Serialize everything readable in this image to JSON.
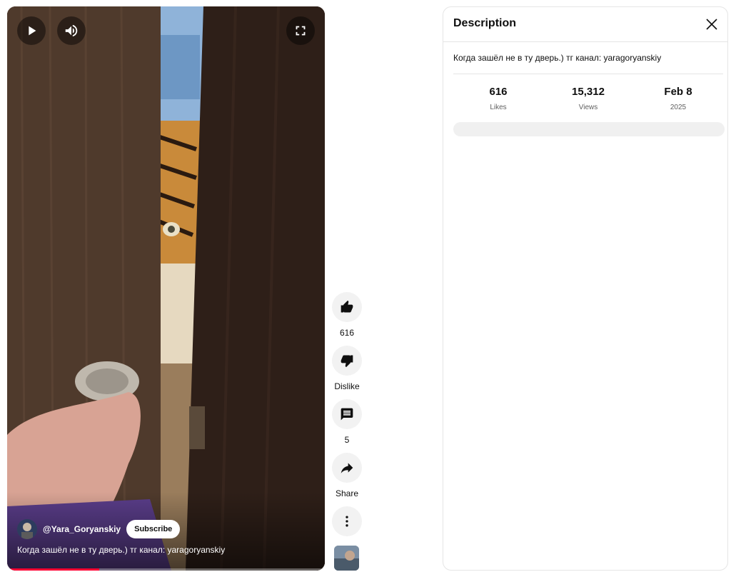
{
  "player": {
    "channel": "@Yara_Goryanskiy",
    "subscribe_label": "Subscribe",
    "caption": "Когда зашёл не в ту дверь.) тг канал: yaragoryanskiy",
    "progress": 0.29,
    "accent_color": "#ff0033"
  },
  "actions": [
    {
      "name": "like",
      "icon": "thumbs-up-icon",
      "label": "616"
    },
    {
      "name": "dislike",
      "icon": "thumbs-down-icon",
      "label": "Dislike"
    },
    {
      "name": "comments",
      "icon": "comment-icon",
      "label": "5"
    },
    {
      "name": "share",
      "icon": "share-icon",
      "label": "Share"
    },
    {
      "name": "more",
      "icon": "more-vert-icon",
      "label": ""
    }
  ],
  "description": {
    "title": "Description",
    "text": "Когда зашёл не в ту дверь.) тг канал: yaragoryanskiy",
    "stats": [
      {
        "value": "616",
        "label": "Likes"
      },
      {
        "value": "15,312",
        "label": "Views"
      },
      {
        "value": "Feb 8",
        "label": "2025"
      }
    ]
  }
}
